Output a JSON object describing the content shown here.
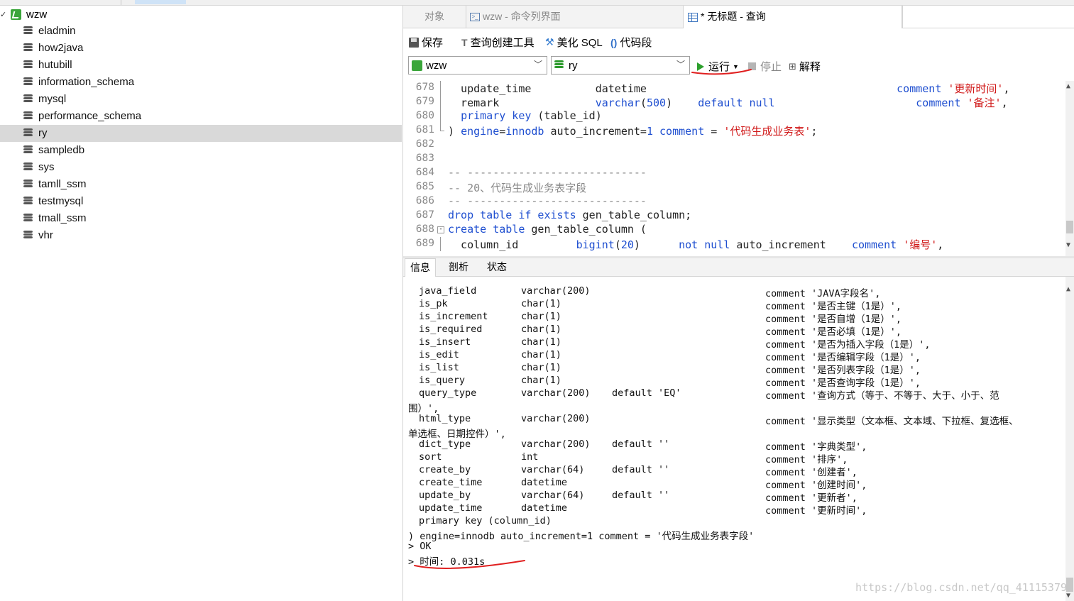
{
  "tree": {
    "connection": "wzw",
    "databases": [
      "eladmin",
      "how2java",
      "hutubill",
      "information_schema",
      "mysql",
      "performance_schema",
      "ry",
      "sampledb",
      "sys",
      "tamll_ssm",
      "testmysql",
      "tmall_ssm",
      "vhr"
    ],
    "selected": "ry"
  },
  "tabs": {
    "objects": "对象",
    "cmd": "wzw - 命令列界面",
    "query": "* 无标题 - 查询"
  },
  "toolbar": {
    "save": "保存",
    "builder": "查询创建工具",
    "beautify": "美化 SQL",
    "snippet": "代码段"
  },
  "runbar": {
    "connection": "wzw",
    "database": "ry",
    "run": "运行",
    "stop": "停止",
    "explain": "解释"
  },
  "editor": {
    "lines": [
      {
        "n": "678",
        "html": "  update_time          datetime                                       <span class=\"kw\">comment</span> <span class=\"str\">'更新时间'</span>,"
      },
      {
        "n": "679",
        "html": "  remark               <span class=\"kw\">varchar</span>(<span class=\"num\">500</span>)    <span class=\"kw\">default</span> <span class=\"kw\">null</span>                      <span class=\"kw\">comment</span> <span class=\"str\">'备注'</span>,"
      },
      {
        "n": "680",
        "html": "  <span class=\"kw\">primary key</span> (table_id)"
      },
      {
        "n": "681",
        "html": ") <span class=\"kw\">engine</span>=<span class=\"kw\">innodb</span> auto_increment=<span class=\"num\">1</span> <span class=\"kw\">comment</span> = <span class=\"str\">'代码生成业务表'</span>;"
      },
      {
        "n": "682",
        "html": ""
      },
      {
        "n": "683",
        "html": ""
      },
      {
        "n": "684",
        "html": "<span class=\"cm\">-- ----------------------------</span>"
      },
      {
        "n": "685",
        "html": "<span class=\"cm\">-- 20、代码生成业务表字段</span>"
      },
      {
        "n": "686",
        "html": "<span class=\"cm\">-- ----------------------------</span>"
      },
      {
        "n": "687",
        "html": "<span class=\"kw\">drop table if exists</span> gen_table_column;"
      },
      {
        "n": "688",
        "html": "<span class=\"kw\">create table</span> gen_table_column ("
      },
      {
        "n": "689",
        "html": "  column_id         <span class=\"kw\">bigint</span>(<span class=\"num\">20</span>)      <span class=\"kw\">not null</span> auto_increment    <span class=\"kw\">comment</span> <span class=\"str\">'编号'</span>,"
      }
    ]
  },
  "bottom_tabs": [
    "信息",
    "剖析",
    "状态"
  ],
  "output": {
    "rows": [
      {
        "name": "java_field",
        "type": "varchar(200)",
        "def": "",
        "cmt": "comment 'JAVA字段名',"
      },
      {
        "name": "is_pk",
        "type": "char(1)",
        "def": "",
        "cmt": "comment '是否主键（1是）',"
      },
      {
        "name": "is_increment",
        "type": "char(1)",
        "def": "",
        "cmt": "comment '是否自增（1是）',"
      },
      {
        "name": "is_required",
        "type": "char(1)",
        "def": "",
        "cmt": "comment '是否必填（1是）',"
      },
      {
        "name": "is_insert",
        "type": "char(1)",
        "def": "",
        "cmt": "comment '是否为插入字段（1是）',"
      },
      {
        "name": "is_edit",
        "type": "char(1)",
        "def": "",
        "cmt": "comment '是否编辑字段（1是）',"
      },
      {
        "name": "is_list",
        "type": "char(1)",
        "def": "",
        "cmt": "comment '是否列表字段（1是）',"
      },
      {
        "name": "is_query",
        "type": "char(1)",
        "def": "",
        "cmt": "comment '是否查询字段（1是）',"
      },
      {
        "name": "query_type",
        "type": "varchar(200)",
        "def": "default 'EQ'",
        "cmt": "comment '查询方式（等于、不等于、大于、小于、范"
      },
      {
        "wrap": "围）',"
      },
      {
        "name": "html_type",
        "type": "varchar(200)",
        "def": "",
        "cmt": "comment '显示类型（文本框、文本域、下拉框、复选框、"
      },
      {
        "wrap": "单选框、日期控件）',"
      },
      {
        "name": "dict_type",
        "type": "varchar(200)",
        "def": "default ''",
        "cmt": "comment '字典类型',"
      },
      {
        "name": "sort",
        "type": "int",
        "def": "",
        "cmt": "comment '排序',"
      },
      {
        "name": "create_by",
        "type": "varchar(64)",
        "def": "default ''",
        "cmt": "comment '创建者',"
      },
      {
        "name": "create_time",
        "type": "datetime",
        "def": "",
        "cmt": "comment '创建时间',"
      },
      {
        "name": "update_by",
        "type": "varchar(64)",
        "def": "default ''",
        "cmt": "comment '更新者',"
      },
      {
        "name": "update_time",
        "type": "datetime",
        "def": "",
        "cmt": "comment '更新时间',"
      },
      {
        "name": "primary key (column_id)",
        "type": "",
        "def": "",
        "cmt": ""
      },
      {
        "wrap": ") engine=innodb auto_increment=1 comment = '代码生成业务表字段'"
      },
      {
        "wrap": "> OK"
      },
      {
        "wrap": "> 时间: 0.031s"
      }
    ]
  },
  "watermark": "https://blog.csdn.net/qq_41115379",
  "colors": {
    "keyword": "#1f4fd0",
    "string": "#d01818",
    "comment": "#8a8a8a",
    "annotation": "#e02020"
  }
}
